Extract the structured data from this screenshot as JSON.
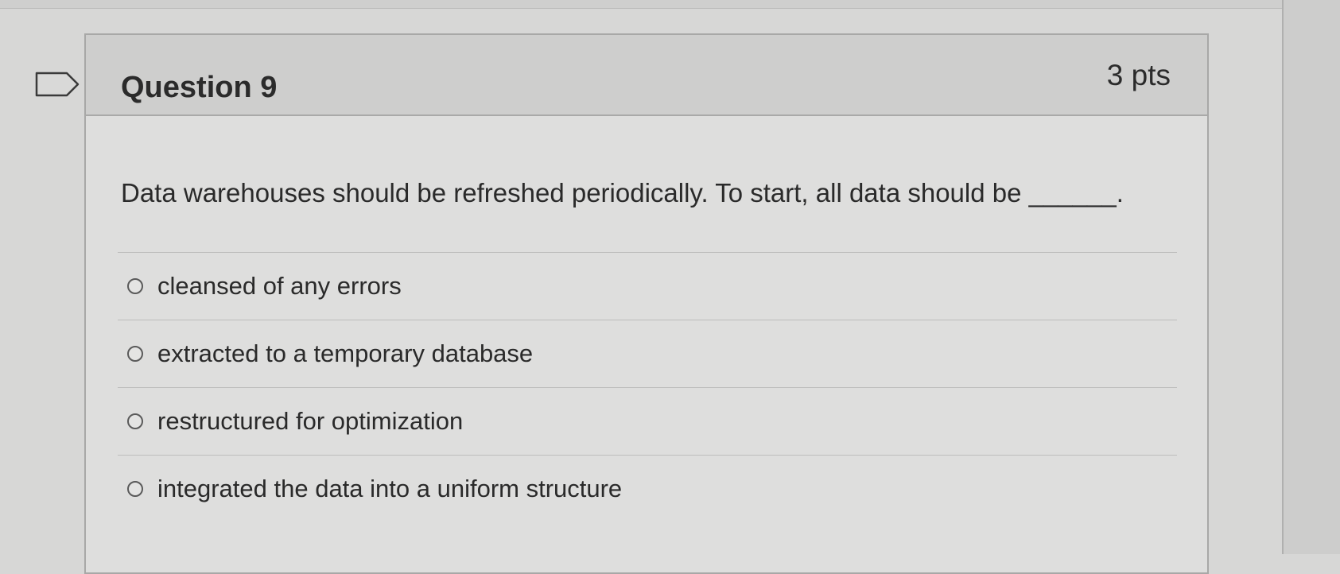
{
  "question": {
    "title": "Question 9",
    "points": "3 pts",
    "text": "Data warehouses should be refreshed periodically. To start, all data should be ______."
  },
  "flag_icon": "flag-outline-icon",
  "answers": [
    {
      "label": "cleansed of any errors",
      "selected": false
    },
    {
      "label": "extracted to a temporary database",
      "selected": false
    },
    {
      "label": "restructured for optimization",
      "selected": false
    },
    {
      "label": "integrated the data into a uniform structure",
      "selected": false
    }
  ]
}
